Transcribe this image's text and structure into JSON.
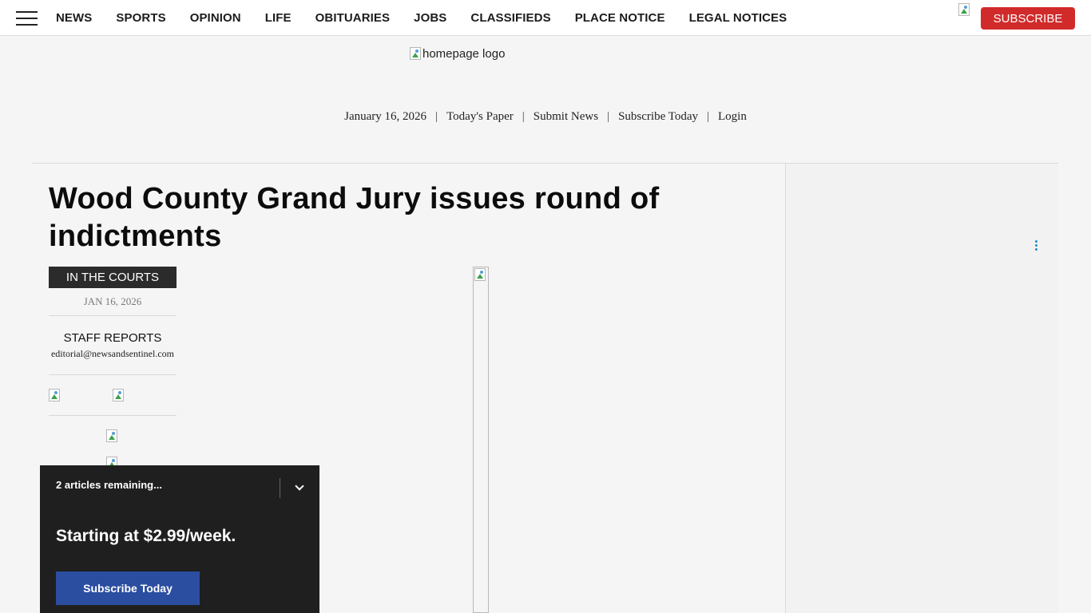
{
  "nav": {
    "menu_icon": "hamburger-icon",
    "links": [
      "NEWS",
      "SPORTS",
      "OPINION",
      "LIFE",
      "OBITUARIES",
      "JOBS",
      "CLASSIFIEDS",
      "PLACE NOTICE",
      "LEGAL NOTICES"
    ],
    "subscribe_label": "SUBSCRIBE"
  },
  "masthead": {
    "logo_alt": "homepage logo",
    "date": "January 16, 2026",
    "links": {
      "todays_paper": "Today's Paper",
      "submit_news": "Submit News",
      "subscribe_today": "Subscribe Today",
      "login": "Login"
    },
    "separator": "|"
  },
  "article": {
    "headline": "Wood County Grand Jury issues round of indictments",
    "section": "IN THE COURTS",
    "date": "JAN 16, 2026",
    "author": "STAFF REPORTS",
    "author_email": "editorial@newsandsentinel.com"
  },
  "meter": {
    "remaining": "2 articles remaining...",
    "price": "Starting at $2.99/week.",
    "cta": "Subscribe Today"
  },
  "colors": {
    "subscribe_red": "#d12a2a",
    "meter_bg": "#1f1f1f",
    "cta_blue": "#2b4ea1",
    "section_tag_bg": "#2b2b2b",
    "page_bg": "#f5f5f5"
  }
}
